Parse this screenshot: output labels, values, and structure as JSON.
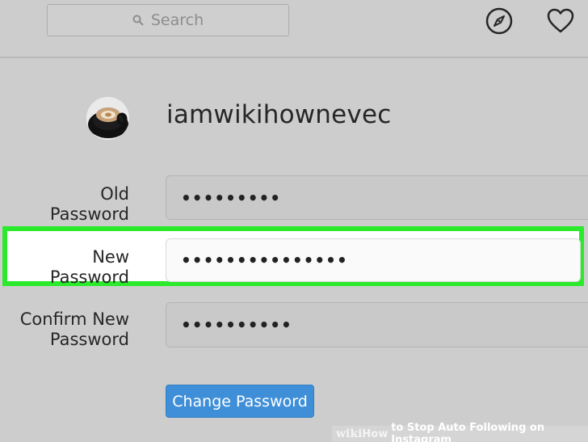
{
  "search": {
    "placeholder": "Search"
  },
  "profile": {
    "username": "iamwikihownevec"
  },
  "fields": {
    "old_password": {
      "label": "Old Password",
      "value": "•••••••••"
    },
    "new_password": {
      "label": "New Password",
      "value": "•••••••••••••••"
    },
    "confirm_password": {
      "label_line1": "Confirm New",
      "label_line2": "Password",
      "value": "••••••••••"
    }
  },
  "actions": {
    "change_password_label": "Change Password"
  },
  "watermark": {
    "wiki": "wiki",
    "how": "How",
    "text": "to Stop Auto Following on Instagram"
  },
  "colors": {
    "highlight": "#2bea2b",
    "button": "#3f8fd8"
  },
  "icons": [
    "search-icon",
    "compass-icon",
    "heart-icon"
  ]
}
